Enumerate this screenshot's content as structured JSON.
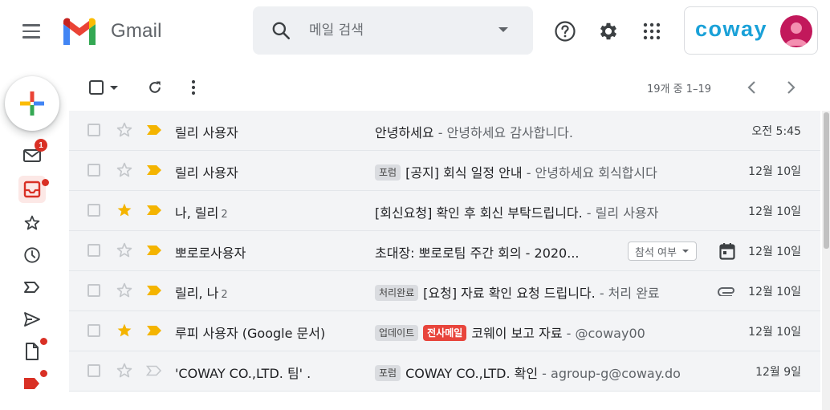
{
  "header": {
    "app_name": "Gmail",
    "search_placeholder": "메일 검색",
    "brand": "coway"
  },
  "rail": {
    "inbox_badge": "1"
  },
  "toolbar": {
    "page_info": "19개 중 1–19"
  },
  "emails": [
    {
      "sender": "릴리 사용자",
      "count": "",
      "labels": [],
      "subject": "안녕하세요",
      "snippet": " - 안녕하세요 감사합니다.",
      "date": "오전 5:45",
      "starred": false,
      "chip": "",
      "icon": ""
    },
    {
      "sender": "릴리 사용자",
      "count": "",
      "labels": [
        {
          "text": "포럼",
          "red": false
        }
      ],
      "subject": "[공지] 회식 일정 안내",
      "snippet": " - 안녕하세요 회식합시다",
      "date": "12월 10일",
      "starred": false,
      "chip": "",
      "icon": ""
    },
    {
      "sender": "나, 릴리",
      "count": "2",
      "labels": [],
      "subject": "[회신요청] 확인 후 회신 부탁드립니다.",
      "snippet": " - 릴리 사용자",
      "date": "12월 10일",
      "starred": true,
      "chip": "",
      "icon": ""
    },
    {
      "sender": "뽀로로사용자",
      "count": "",
      "labels": [],
      "subject": "초대장: 뽀로로팀 주간 회의 - 2020...",
      "snippet": "",
      "date": "12월 10일",
      "starred": false,
      "chip": "참석 여부",
      "icon": "calendar-icon"
    },
    {
      "sender": "릴리, 나",
      "count": "2",
      "labels": [
        {
          "text": "처리완료",
          "red": false
        }
      ],
      "subject": "[요청] 자료 확인 요청 드립니다.",
      "snippet": " - 처리 완료",
      "date": "12월 10일",
      "starred": false,
      "chip": "",
      "icon": "attachment-icon"
    },
    {
      "sender": "루피 사용자 (Google 문서)",
      "count": "",
      "labels": [
        {
          "text": "업데이트",
          "red": false
        },
        {
          "text": "전사메일",
          "red": true
        }
      ],
      "subject": "코웨이 보고 자료",
      "snippet": " - @coway00",
      "date": "12월 10일",
      "starred": true,
      "chip": "",
      "icon": ""
    },
    {
      "sender": "'COWAY CO.,LTD. 팀' .",
      "count": "",
      "labels": [
        {
          "text": "포럼",
          "red": false
        }
      ],
      "subject": "COWAY CO.,LTD. 확인",
      "snippet": " - agroup-g@coway.do",
      "date": "12월 9일",
      "starred": false,
      "chip": "",
      "icon": ""
    }
  ],
  "colors": {
    "important": "#f4b400",
    "star": "#f4b400",
    "badge": "#d93025",
    "brand": "#1aa1d8"
  }
}
